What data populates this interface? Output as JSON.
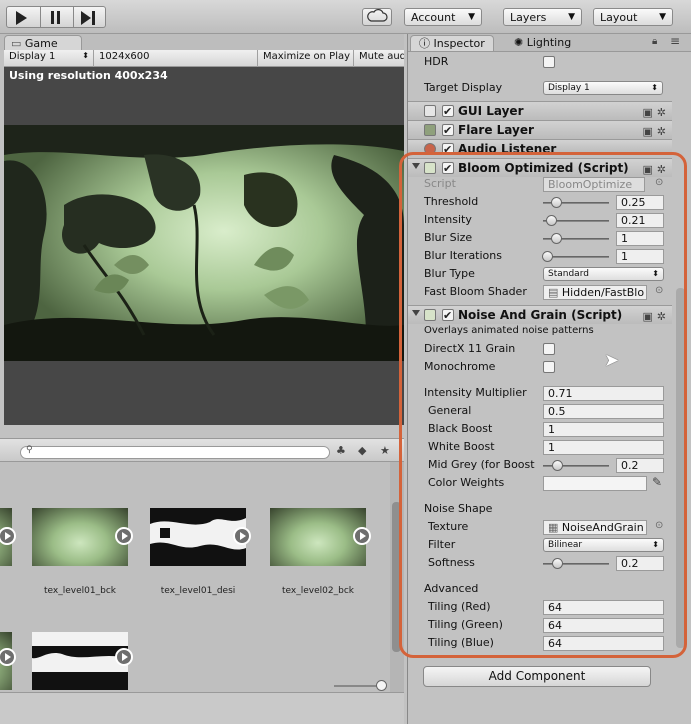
{
  "toolbar": {
    "cloud_icon": "cloud-icon",
    "account": "Account",
    "layers": "Layers",
    "layout": "Layout"
  },
  "game": {
    "tab": "Game",
    "display": "Display 1",
    "resolution": "1024x600",
    "maximize": "Maximize on Play",
    "mute": "Mute aud",
    "overlay": "Using resolution 400x234"
  },
  "project": {
    "thumbnails": [
      {
        "label": "tex_level01_bck"
      },
      {
        "label": "tex_level01_desi"
      },
      {
        "label": "tex_level02_bck"
      }
    ]
  },
  "inspector": {
    "tab_inspector": "Inspector",
    "tab_lighting": "Lighting",
    "hdr_label": "HDR",
    "target_display_label": "Target Display",
    "target_display_value": "Display 1",
    "components": {
      "gui_layer": "GUI Layer",
      "flare_layer": "Flare Layer",
      "audio_listener": "Audio Listener"
    },
    "bloom": {
      "title": "Bloom Optimized (Script)",
      "script_label": "Script",
      "script_value": "BloomOptimize",
      "threshold_label": "Threshold",
      "threshold": "0.25",
      "intensity_label": "Intensity",
      "intensity": "0.21",
      "blur_size_label": "Blur Size",
      "blur_size": "1",
      "blur_iter_label": "Blur Iterations",
      "blur_iter": "1",
      "blur_type_label": "Blur Type",
      "blur_type": "Standard",
      "shader_label": "Fast Bloom Shader",
      "shader_value": "Hidden/FastBlo"
    },
    "noise": {
      "title": "Noise And Grain (Script)",
      "description": "Overlays animated noise patterns",
      "dx11_label": "DirectX 11 Grain",
      "mono_label": "Monochrome",
      "intensity_mult_label": "Intensity Multiplier",
      "intensity_mult": "0.71",
      "general_label": "General",
      "general": "0.5",
      "black_boost_label": "Black Boost",
      "black_boost": "1",
      "white_boost_label": "White Boost",
      "white_boost": "1",
      "mid_grey_label": "Mid Grey (for Boost",
      "mid_grey": "0.2",
      "color_weights_label": "Color Weights",
      "noise_shape_label": "Noise Shape",
      "texture_label": "Texture",
      "texture_value": "NoiseAndGrain",
      "filter_label": "Filter",
      "filter_value": "Bilinear",
      "softness_label": "Softness",
      "softness": "0.2",
      "advanced_label": "Advanced",
      "tiling_red_label": "Tiling (Red)",
      "tiling_red": "64",
      "tiling_green_label": "Tiling (Green)",
      "tiling_green": "64",
      "tiling_blue_label": "Tiling (Blue)",
      "tiling_blue": "64"
    },
    "add_component": "Add Component"
  },
  "colors": {
    "highlight": "#d4633a",
    "scene_green": "#9bbd87"
  }
}
